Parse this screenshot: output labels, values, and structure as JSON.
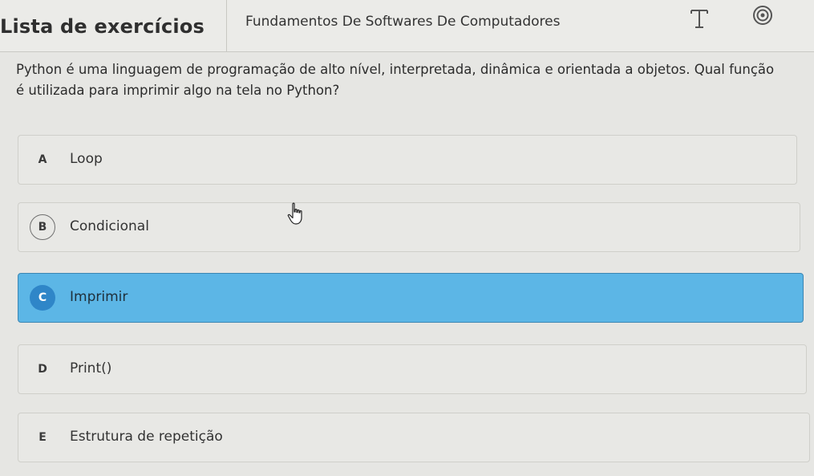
{
  "header": {
    "title": "Lista de exercícios",
    "subject": "Fundamentos De Softwares De Computadores",
    "icons": {
      "text_tool": "text-tool-icon",
      "target": "target-icon"
    }
  },
  "question": {
    "text": "Python é uma linguagem de programação de alto nível, interpretada, dinâmica e orientada a objetos. Qual função é utilizada para imprimir algo na tela no Python?"
  },
  "options": [
    {
      "letter": "A",
      "label": "Loop",
      "selected": false
    },
    {
      "letter": "B",
      "label": "Condicional",
      "selected": false
    },
    {
      "letter": "C",
      "label": "Imprimir",
      "selected": true
    },
    {
      "letter": "D",
      "label": "Print()",
      "selected": false
    },
    {
      "letter": "E",
      "label": "Estrutura de repetição",
      "selected": false
    }
  ],
  "colors": {
    "selected_bg": "#5cb6e6",
    "selected_badge": "#2f86c8",
    "page_bg": "#e6e6e3"
  }
}
